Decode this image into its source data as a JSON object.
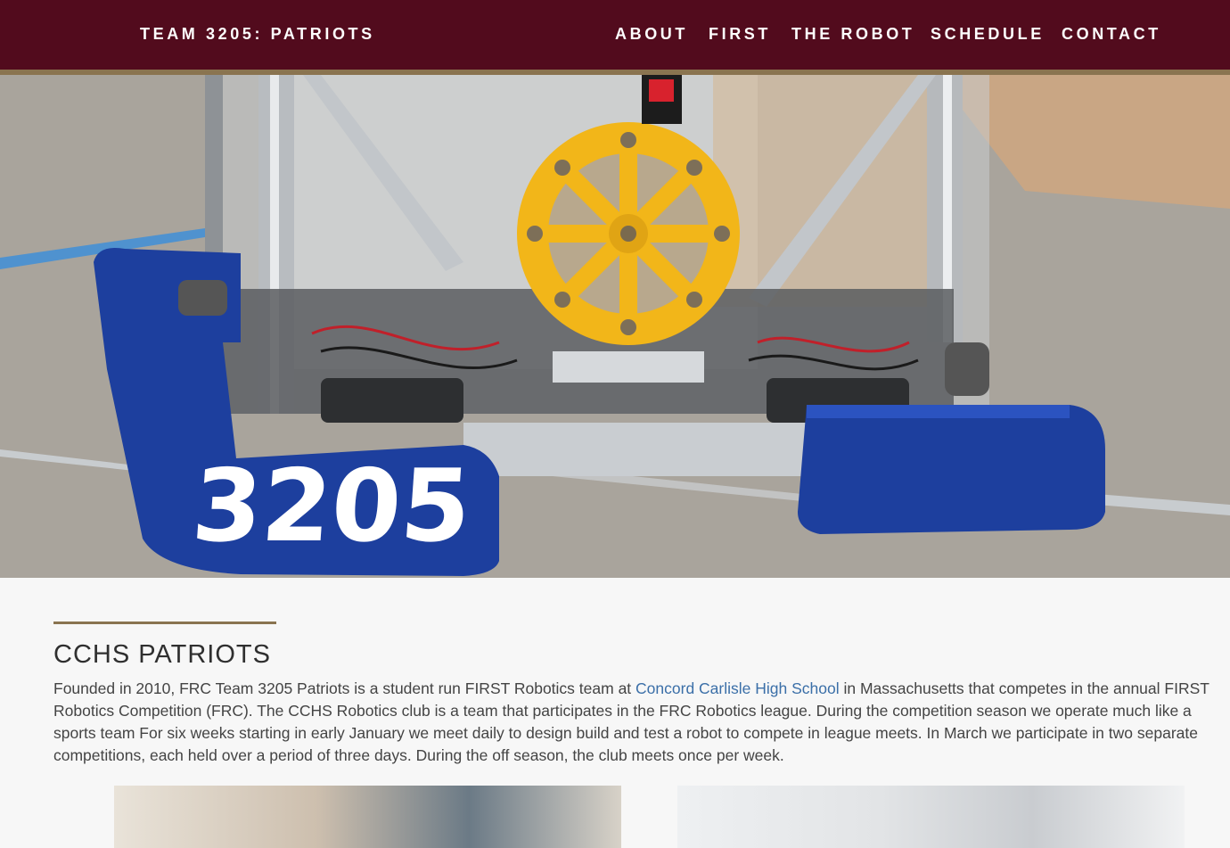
{
  "nav": {
    "brand": "TEAM 3205:  PATRIOTS",
    "links": [
      "ABOUT",
      "FIRST",
      "THE ROBOT",
      "SCHEDULE",
      "CONTACT"
    ]
  },
  "hero": {
    "robot_number": "3205",
    "slides": 4,
    "active_slide": 1
  },
  "about": {
    "title": "CCHS  PATRIOTS",
    "paragraph_before_link": "Founded in 2010, FRC Team 3205 Patriots is a student run FIRST Robotics team at ",
    "link_text": "Concord Carlisle High School",
    "paragraph_after_link": " in Massachusetts that competes in the annual FIRST Robotics Competition (FRC). The CCHS Robotics club is a team that participates in the FRC Robotics league. During the competition season we operate much like a sports team For six weeks starting in early January we meet daily to design build and test a robot to compete in league meets. In March we participate in two separate competitions, each held over a period of three days. During the off season, the club meets once per week."
  },
  "colors": {
    "nav_bg": "#520b1d",
    "accent_gold": "#8a7450",
    "link_blue": "#3b6fa8",
    "bumper_blue": "#1d3f9e",
    "gear_yellow": "#f2b619"
  }
}
